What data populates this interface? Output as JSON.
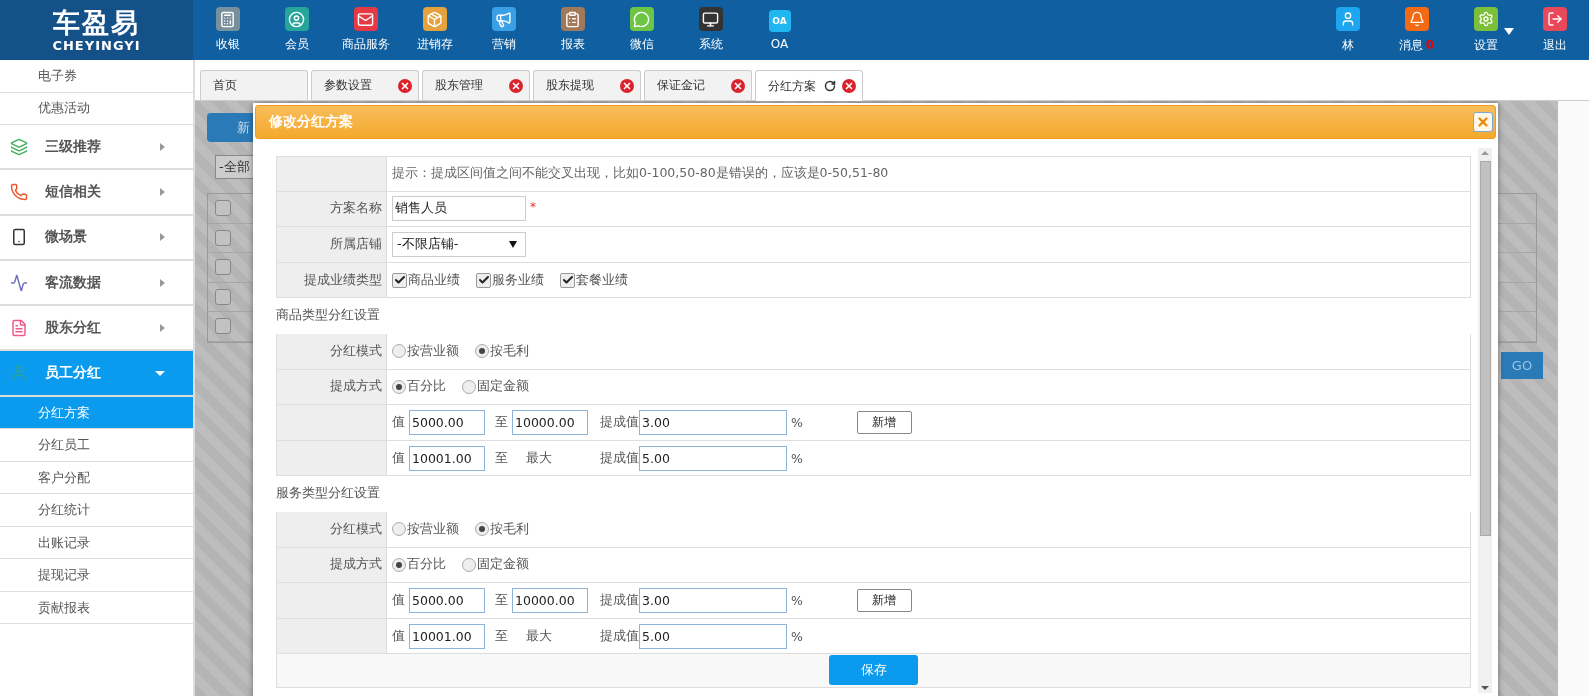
{
  "brand": {
    "logo": "车盈易",
    "subtitle": "CHEYINGYI"
  },
  "nav": [
    {
      "label": "收银"
    },
    {
      "label": "会员"
    },
    {
      "label": "商品服务"
    },
    {
      "label": "进销存"
    },
    {
      "label": "营销"
    },
    {
      "label": "报表"
    },
    {
      "label": "微信"
    },
    {
      "label": "系统"
    },
    {
      "label": "OA",
      "icon_text": "OA"
    }
  ],
  "user_menu": [
    {
      "label": "林"
    },
    {
      "label": "消息",
      "badge": "0"
    },
    {
      "label": "设置",
      "dropdown": true
    },
    {
      "label": "退出"
    }
  ],
  "sidebar": {
    "items": [
      {
        "kind": "sub",
        "label": "电子券",
        "selected": false
      },
      {
        "kind": "sub",
        "label": "优惠活动",
        "selected": false
      },
      {
        "kind": "group",
        "label": "三级推荐",
        "expanded": false
      },
      {
        "kind": "group",
        "label": "短信相关",
        "expanded": false
      },
      {
        "kind": "group",
        "label": "微场景",
        "expanded": false
      },
      {
        "kind": "group",
        "label": "客流数据",
        "expanded": false
      },
      {
        "kind": "group",
        "label": "股东分红",
        "expanded": false
      },
      {
        "kind": "group",
        "label": "员工分红",
        "expanded": true,
        "children": [
          {
            "label": "分红方案",
            "selected": true
          },
          {
            "label": "分红员工",
            "selected": false
          },
          {
            "label": "客户分配",
            "selected": false
          },
          {
            "label": "分红统计",
            "selected": false
          },
          {
            "label": "出账记录",
            "selected": false
          },
          {
            "label": "提现记录",
            "selected": false
          },
          {
            "label": "贡献报表",
            "selected": false
          }
        ]
      }
    ]
  },
  "tabs": [
    {
      "label": "首页",
      "selected": false,
      "closable": false
    },
    {
      "label": "参数设置",
      "selected": false,
      "closable": true
    },
    {
      "label": "股东管理",
      "selected": false,
      "closable": true
    },
    {
      "label": "股东提现",
      "selected": false,
      "closable": true
    },
    {
      "label": "保证金记",
      "selected": false,
      "closable": true
    },
    {
      "label": "分红方案",
      "selected": true,
      "closable": true
    }
  ],
  "background_page": {
    "new_button": "新",
    "filter_select": "-全部",
    "checkboxes": [
      {
        "checked": false
      },
      {
        "checked": false
      },
      {
        "checked": false
      },
      {
        "checked": false
      },
      {
        "checked": false
      }
    ],
    "go_button": "GO"
  },
  "modal": {
    "title": "修改分红方案",
    "hint": "提示：提成区间值之间不能交叉出现，比如0-100,50-80是错误的，应该是0-50,51-80",
    "name": {
      "label": "方案名称",
      "value": "销售人员",
      "required_mark": "*"
    },
    "shop": {
      "label": "所属店铺",
      "value": "-不限店铺-"
    },
    "types": {
      "label": "提成业绩类型",
      "options": [
        {
          "label": "商品业绩",
          "checked": true
        },
        {
          "label": "服务业绩",
          "checked": true
        },
        {
          "label": "套餐业绩",
          "checked": true
        }
      ]
    },
    "sections": [
      {
        "title": "商品类型分红设置",
        "mode": {
          "label": "分红模式",
          "options": [
            {
              "label": "按营业额",
              "selected": false
            },
            {
              "label": "按毛利",
              "selected": true
            }
          ]
        },
        "method": {
          "label": "提成方式",
          "options": [
            {
              "label": "百分比",
              "selected": true
            },
            {
              "label": "固定金额",
              "selected": false
            }
          ]
        },
        "ranges": [
          {
            "from_label": "值",
            "from": "5000.00",
            "to_label": "至",
            "to": {
              "kind": "input",
              "value": "10000.00"
            },
            "rate_label": "提成值",
            "rate": "3.00",
            "unit": "%",
            "add_button": "新增"
          },
          {
            "from_label": "值",
            "from": "10001.00",
            "to_label": "至",
            "to": {
              "kind": "text",
              "value": "最大"
            },
            "rate_label": "提成值",
            "rate": "5.00",
            "unit": "%"
          }
        ]
      },
      {
        "title": "服务类型分红设置",
        "mode": {
          "label": "分红模式",
          "options": [
            {
              "label": "按营业额",
              "selected": false
            },
            {
              "label": "按毛利",
              "selected": true
            }
          ]
        },
        "method": {
          "label": "提成方式",
          "options": [
            {
              "label": "百分比",
              "selected": true
            },
            {
              "label": "固定金额",
              "selected": false
            }
          ]
        },
        "ranges": [
          {
            "from_label": "值",
            "from": "5000.00",
            "to_label": "至",
            "to": {
              "kind": "input",
              "value": "10000.00"
            },
            "rate_label": "提成值",
            "rate": "3.00",
            "unit": "%",
            "add_button": "新增"
          },
          {
            "from_label": "值",
            "from": "10001.00",
            "to_label": "至",
            "to": {
              "kind": "text",
              "value": "最大"
            },
            "rate_label": "提成值",
            "rate": "5.00",
            "unit": "%"
          }
        ]
      }
    ],
    "save_button": "保存"
  }
}
